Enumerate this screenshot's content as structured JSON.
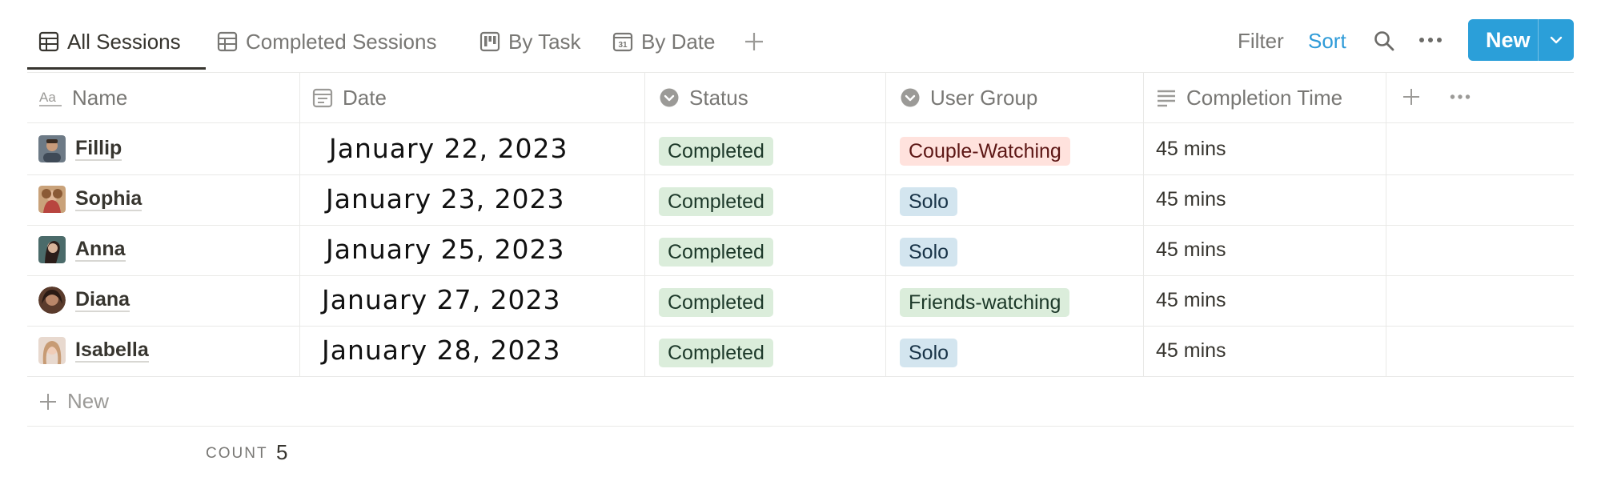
{
  "views": {
    "tabs": [
      {
        "label": "All Sessions",
        "icon": "table-icon"
      },
      {
        "label": "Completed Sessions",
        "icon": "table-icon"
      },
      {
        "label": "By Task",
        "icon": "board-icon"
      },
      {
        "label": "By Date",
        "icon": "calendar-icon"
      }
    ],
    "calendar_icon_text": "31"
  },
  "toolbar": {
    "filter_label": "Filter",
    "sort_label": "Sort",
    "new_label": "New",
    "accent_color": "#2b9fd9"
  },
  "table": {
    "columns": [
      {
        "label": "Name",
        "icon": "text-aa-icon",
        "icon_text": "Aa"
      },
      {
        "label": "Date",
        "icon": "calendar-icon"
      },
      {
        "label": "Status",
        "icon": "select-icon"
      },
      {
        "label": "User Group",
        "icon": "select-icon"
      },
      {
        "label": "Completion Time",
        "icon": "text-lines-icon"
      }
    ],
    "rows": [
      {
        "name": "Fillip",
        "date": "January 22, 2023",
        "status": "Completed",
        "group": "Couple-Watching",
        "time": "45 mins"
      },
      {
        "name": "Sophia",
        "date": "January 23, 2023",
        "status": "Completed",
        "group": "Solo",
        "time": "45 mins"
      },
      {
        "name": "Anna",
        "date": "January 25, 2023",
        "status": "Completed",
        "group": "Solo",
        "time": "45 mins"
      },
      {
        "name": "Diana",
        "date": "January 27, 2023",
        "status": "Completed",
        "group": "Friends-watching",
        "time": "45 mins"
      },
      {
        "name": "Isabella",
        "date": "January 28, 2023",
        "status": "Completed",
        "group": "Solo",
        "time": "45 mins"
      }
    ],
    "add_row_label": "New",
    "count_label": "COUNT",
    "count_value": "5"
  },
  "colors": {
    "status_green_bg": "#dbeddb",
    "group_red_bg": "#ffe2dd",
    "group_blue_bg": "#d3e5ef"
  }
}
